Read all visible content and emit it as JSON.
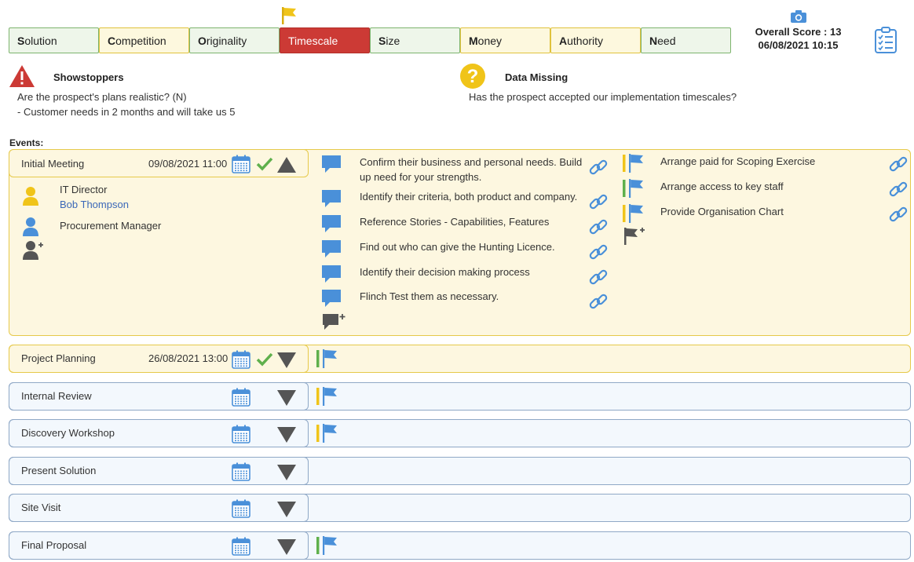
{
  "tabs": [
    {
      "first": "S",
      "rest": "olution",
      "state": "green"
    },
    {
      "first": "C",
      "rest": "ompetition",
      "state": "yellow"
    },
    {
      "first": "O",
      "rest": "riginality",
      "state": "green"
    },
    {
      "first": "",
      "rest": "Timescale",
      "state": "red"
    },
    {
      "first": "S",
      "rest": "ize",
      "state": "green"
    },
    {
      "first": "M",
      "rest": "oney",
      "state": "yellow"
    },
    {
      "first": "A",
      "rest": "uthority",
      "state": "yellow"
    },
    {
      "first": "N",
      "rest": "eed",
      "state": "green"
    }
  ],
  "score": {
    "label": "Overall Score : 13",
    "datetime": "06/08/2021 10:15"
  },
  "showstoppers": {
    "title": "Showstoppers",
    "lines": [
      "Are the prospect's plans realistic? (N)",
      "- Customer needs in 2 months and will take us 5"
    ]
  },
  "data_missing": {
    "title": "Data Missing",
    "lines": [
      "Has the prospect accepted our implementation timescales?"
    ]
  },
  "events_label": "Events:",
  "expanded_event": {
    "name": "Initial Meeting",
    "date": "09/08/2021 11:00",
    "contacts": [
      {
        "role": "IT Director",
        "name": "Bob Thompson"
      },
      {
        "role": "Procurement Manager",
        "name": ""
      }
    ],
    "objectives": [
      [
        "Confirm their business and personal needs. Build",
        "up need for your strengths."
      ],
      [
        "Identify their criteria, both product and company."
      ],
      [
        "Reference Stories - Capabilities, Features"
      ],
      [
        "Find out who can give the Hunting Licence."
      ],
      [
        "Identify their decision making process"
      ],
      [
        "Flinch Test them as necessary."
      ]
    ],
    "actions": [
      {
        "text": "Arrange paid for Scoping Exercise",
        "status": "#f0c419"
      },
      {
        "text": "Arrange access to key staff",
        "status": "#5fb04c"
      },
      {
        "text": "Provide Organisation Chart",
        "status": "#f0c419"
      }
    ]
  },
  "events": [
    {
      "name": "Project Planning",
      "date": "26/08/2021 13:00",
      "style": "yellow",
      "done": true,
      "flag": "#5fb04c"
    },
    {
      "name": "Internal Review",
      "date": "",
      "style": "blue",
      "done": false,
      "flag": "#f0c419"
    },
    {
      "name": "Discovery Workshop",
      "date": "",
      "style": "blue",
      "done": false,
      "flag": "#f0c419"
    },
    {
      "name": "Present Solution",
      "date": "",
      "style": "blue",
      "done": false,
      "flag": ""
    },
    {
      "name": "Site Visit",
      "date": "",
      "style": "blue",
      "done": false,
      "flag": ""
    },
    {
      "name": "Final Proposal",
      "date": "",
      "style": "blue",
      "done": false,
      "flag": "#5fb04c"
    }
  ],
  "colors": {
    "accent_blue": "#4a90d9",
    "red": "#cc3a35",
    "yellow": "#f0c419",
    "green": "#5fb04c"
  }
}
